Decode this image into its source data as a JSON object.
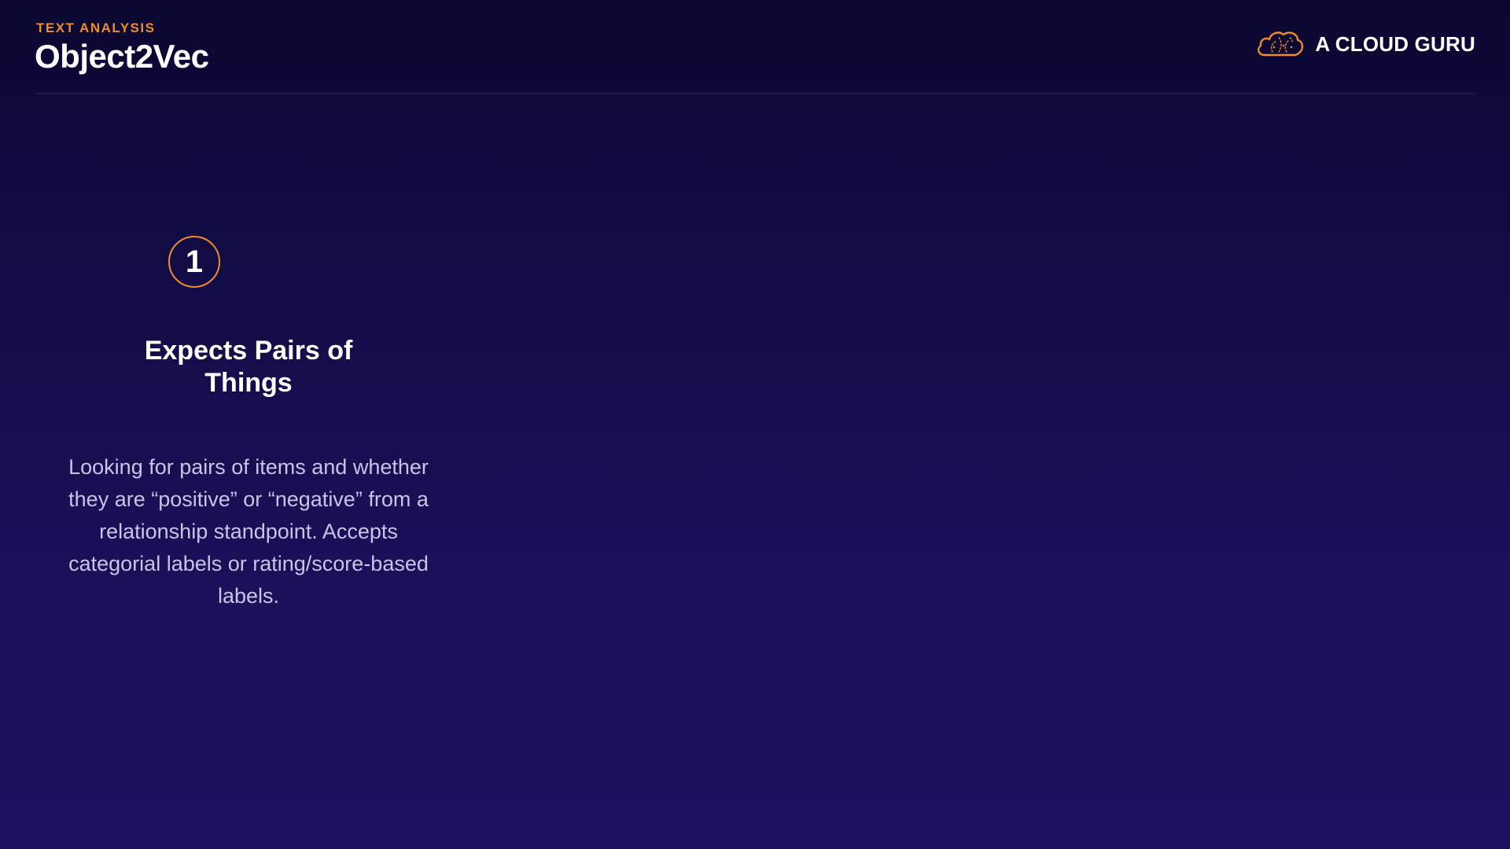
{
  "header": {
    "eyebrow": "TEXT ANALYSIS",
    "title": "Object2Vec",
    "brand": {
      "name": "A CLOUD GURU",
      "icon": "cloud-logo-icon",
      "accent_color": "#f08a2e"
    }
  },
  "step": {
    "number": "1",
    "title": "Expects Pairs of\nThings",
    "description": "Looking for pairs of items and whether\nthey are “positive” or “negative” from a\nrelationship standpoint.   Accepts\ncategorial labels or rating/score-based\nlabels."
  },
  "colors": {
    "background_top": "#0a0730",
    "background_bottom": "#1c1260",
    "accent": "#f08a2e",
    "body_text": "#c9c4e6"
  }
}
